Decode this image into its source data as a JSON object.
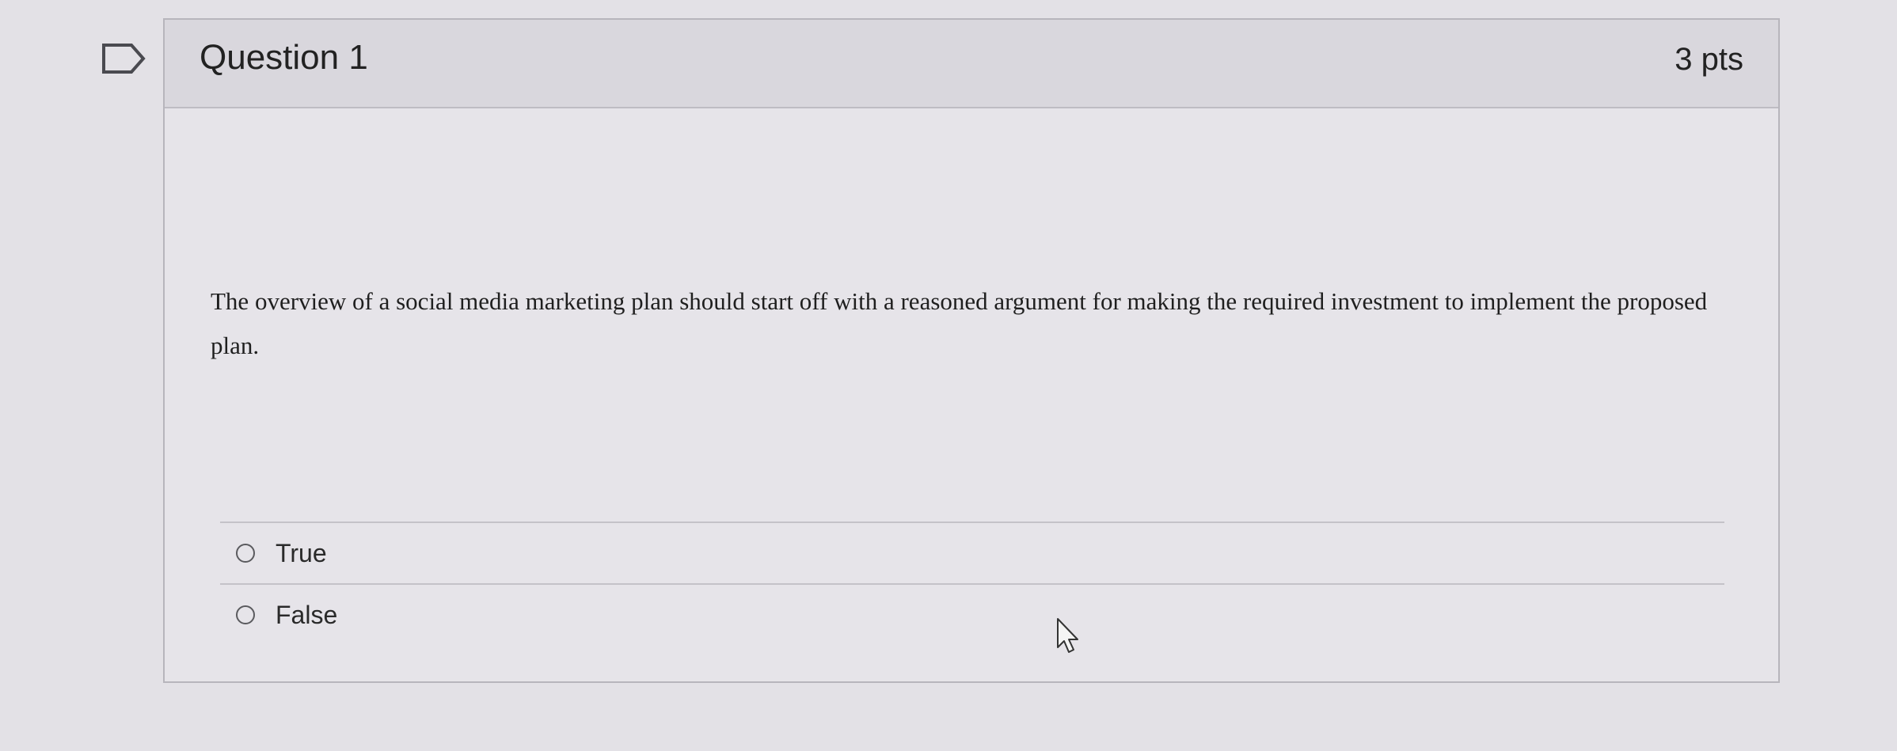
{
  "question": {
    "title": "Question 1",
    "points": "3 pts",
    "text": "The overview of a social media marketing plan should start off with a reasoned argument for making the required investment to implement the proposed plan."
  },
  "answers": [
    {
      "label": "True",
      "selected": false
    },
    {
      "label": "False",
      "selected": false
    }
  ],
  "icons": {
    "bookmark": "flag-bookmark-icon",
    "cursor": "mouse-pointer-icon"
  }
}
